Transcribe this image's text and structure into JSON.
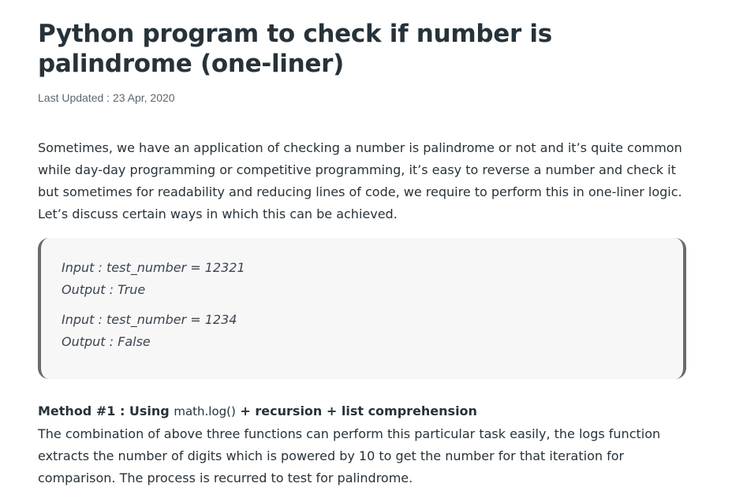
{
  "article": {
    "title": "Python program to check if number is palindrome (one-liner)",
    "last_updated": "Last Updated : 23 Apr, 2020",
    "intro": "Sometimes, we have an application of checking a number is palindrome or not and it’s quite common while day-day programming or competitive programming, it’s easy to reverse a number and check it but sometimes for readability and reducing lines of code, we require to perform this in one-liner logic. Let’s discuss certain ways in which this can be achieved.",
    "examples": [
      {
        "input": "Input : test_number = 12321",
        "output": "Output : True"
      },
      {
        "input": "Input : test_number = 1234",
        "output": "Output : False"
      }
    ],
    "method": {
      "prefix": "Method #1 : Using ",
      "code": "math.log()",
      "suffix": " + recursion + list comprehension",
      "description": "The combination of above three functions can perform this particular task easily, the logs function extracts the number of digits which is powered by 10 to get the number for that iteration for comparison. The process is recurred to test for palindrome."
    }
  }
}
